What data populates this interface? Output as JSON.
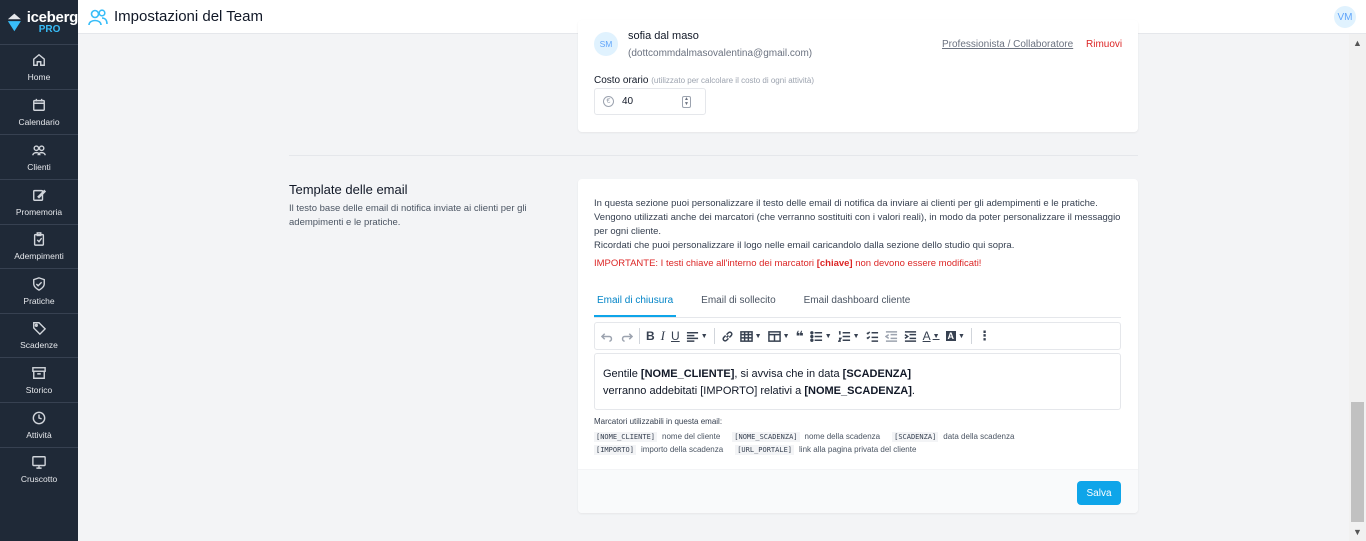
{
  "sidebar": {
    "logo_main": "iceberg",
    "logo_sub": "PRO",
    "items": [
      {
        "label": "Home",
        "icon": "home-icon"
      },
      {
        "label": "Calendario",
        "icon": "calendar-icon"
      },
      {
        "label": "Clienti",
        "icon": "clients-icon"
      },
      {
        "label": "Promemoria",
        "icon": "pencil-icon"
      },
      {
        "label": "Adempimenti",
        "icon": "clipboard-icon"
      },
      {
        "label": "Pratiche",
        "icon": "shield-icon"
      },
      {
        "label": "Scadenze",
        "icon": "tag-icon"
      },
      {
        "label": "Storico",
        "icon": "archive-icon"
      },
      {
        "label": "Attività",
        "icon": "clock-icon"
      },
      {
        "label": "Cruscotto",
        "icon": "monitor-icon"
      }
    ]
  },
  "header": {
    "title": "Impostazioni del Team",
    "user_initials": "VM"
  },
  "member": {
    "initials": "SM",
    "name": "sofia dal maso",
    "email": "(dottcommdalmasovalentina@gmail.com)",
    "role": "Professionista / Collaboratore",
    "remove_label": "Rimuovi",
    "cost_label": "Costo orario",
    "cost_hint": "(utilizzato per calcolare il costo di ogni attività)",
    "cost_value": "40"
  },
  "email_section": {
    "title": "Template delle email",
    "description": "Il testo base delle email di notifica inviate ai clienti per gli adempimenti e le pratiche.",
    "intro_1": "In questa sezione puoi personalizzare il testo delle email di notifica da inviare ai clienti per gli adempimenti e le pratiche.",
    "intro_2": "Vengono utilizzati anche dei marcatori (che verranno sostituiti con i valori reali), in modo da poter personalizzare il messaggio per ogni cliente.",
    "intro_3": "Ricordati che puoi personalizzare il logo nelle email caricandolo dalla sezione dello studio qui sopra.",
    "important_pre": "IMPORTANTE: I testi chiave all'interno dei marcatori ",
    "important_key": "[chiave]",
    "important_post": " non devono essere modificati!",
    "tabs": [
      "Email di chiusura",
      "Email di sollecito",
      "Email dashboard cliente"
    ],
    "editor": {
      "l1_a": "Gentile ",
      "l1_b": "[NOME_CLIENTE]",
      "l1_c": ", si avvisa che in data ",
      "l1_d": "[SCADENZA]",
      "l2_a": "verranno addebitati [IMPORTO] relativi a ",
      "l2_b": "[NOME_SCADENZA]",
      "l2_c": "."
    },
    "markers_title": "Marcatori utilizzabili in questa email:",
    "markers": [
      {
        "code": "[NOME_CLIENTE]",
        "desc": "nome del cliente"
      },
      {
        "code": "[NOME_SCADENZA]",
        "desc": "nome della scadenza"
      },
      {
        "code": "[SCADENZA]",
        "desc": "data della scadenza"
      },
      {
        "code": "[IMPORTO]",
        "desc": "importo della scadenza"
      },
      {
        "code": "[URL_PORTALE]",
        "desc": "link alla pagina privata del cliente"
      }
    ],
    "save_label": "Salva"
  },
  "colors": {
    "sidebar_bg": "#1f2937",
    "accent": "#0ea5e9",
    "danger": "#dc2626"
  }
}
